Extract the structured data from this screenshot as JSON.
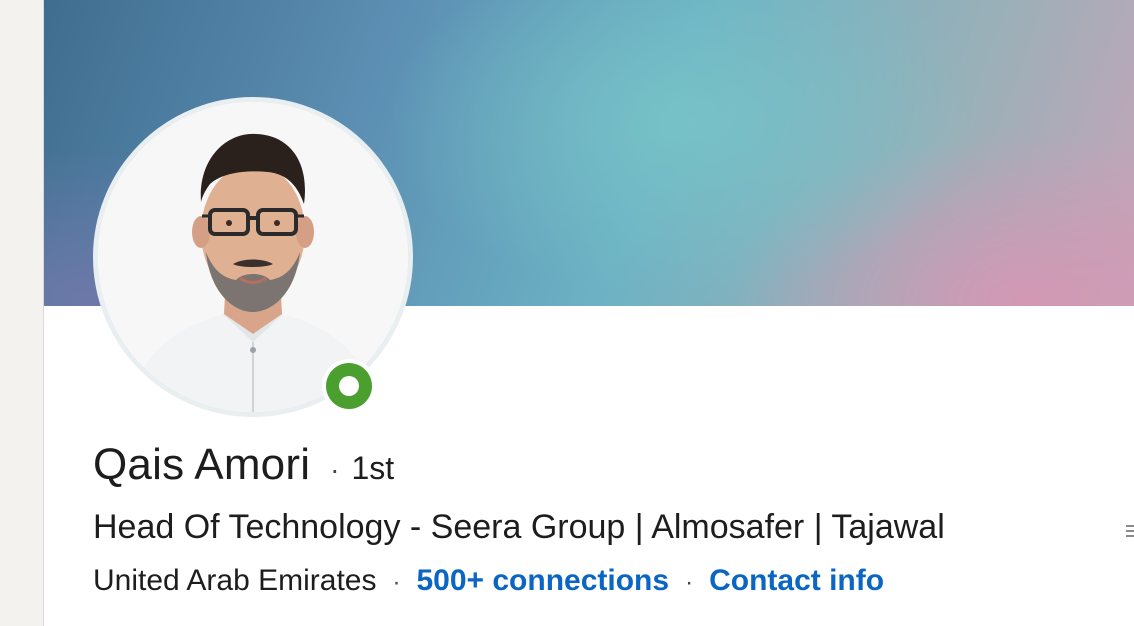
{
  "profile": {
    "name": "Qais Amori",
    "degree_separator": "·",
    "degree": "1st",
    "headline": "Head Of Technology - Seera Group | Almosafer | Tajawal",
    "location": "United Arab Emirates",
    "meta_separator": "·",
    "connections": "500+ connections",
    "contact_info": "Contact info",
    "presence_status": "online"
  },
  "colors": {
    "link": "#0a66c2",
    "presence": "#4a9f2f",
    "text": "#1d1d1d"
  },
  "icons": {
    "presence": "online-status-icon",
    "edge": "overflow-icon"
  }
}
